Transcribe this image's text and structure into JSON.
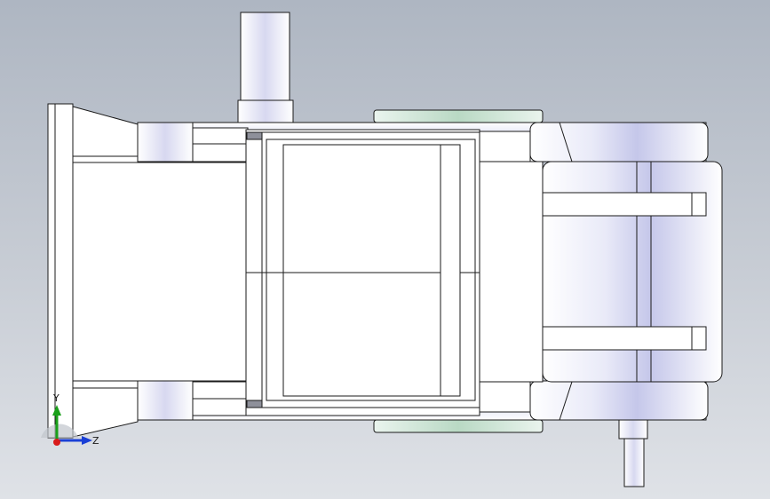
{
  "viewport": {
    "background_top": "#aeb6c2",
    "background_bottom": "#dfe2e7",
    "edge_color": "#1a1a1a",
    "face_color": "#ffffff",
    "shade_color": "#c9cbea",
    "accent_green": "#cfe6d6"
  },
  "triad": {
    "y_label": "Y",
    "z_label": "Z",
    "y_color": "#1aa01a",
    "z_color": "#1a3fd6",
    "x_color": "#d81a1a"
  }
}
